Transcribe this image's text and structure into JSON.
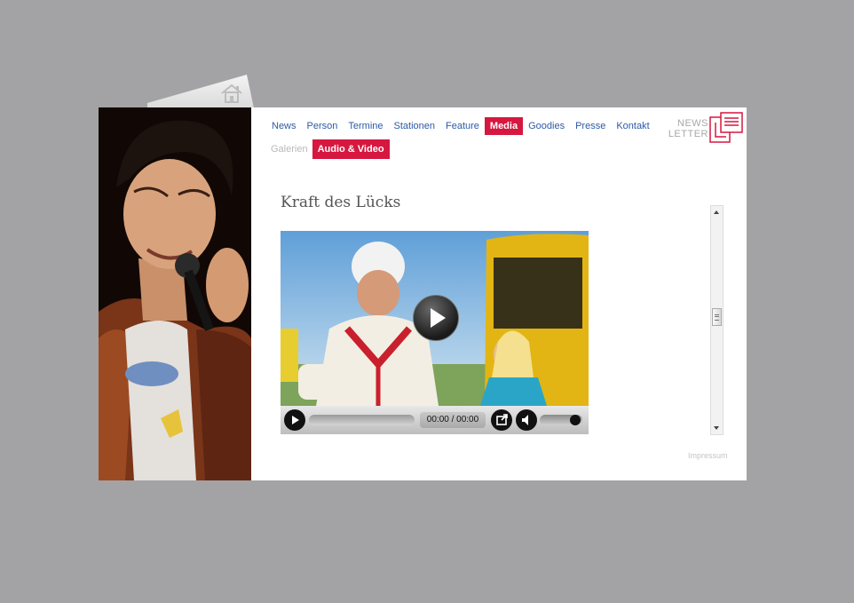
{
  "nav": {
    "items": [
      {
        "label": "News"
      },
      {
        "label": "Person"
      },
      {
        "label": "Termine"
      },
      {
        "label": "Stationen"
      },
      {
        "label": "Feature"
      },
      {
        "label": "Media",
        "active": true
      },
      {
        "label": "Goodies"
      },
      {
        "label": "Presse"
      },
      {
        "label": "Kontakt"
      }
    ]
  },
  "subnav": {
    "items": [
      {
        "label": "Galerien"
      },
      {
        "label": "Audio & Video",
        "active": true
      }
    ]
  },
  "newsletter": {
    "line1": "NEWS",
    "line2": "LETTER"
  },
  "content": {
    "title": "Kraft des Lücks"
  },
  "player": {
    "time": "00:00 / 00:00",
    "volume_level": 1.0,
    "progress": 0
  },
  "footer": {
    "impressum": "Impressum"
  },
  "colors": {
    "accent": "#d6173f",
    "nav_link": "#2c5aa8",
    "background": "#a3a3a5"
  },
  "icons": {
    "home": "home-icon",
    "newsletter": "newsletter-icon"
  }
}
